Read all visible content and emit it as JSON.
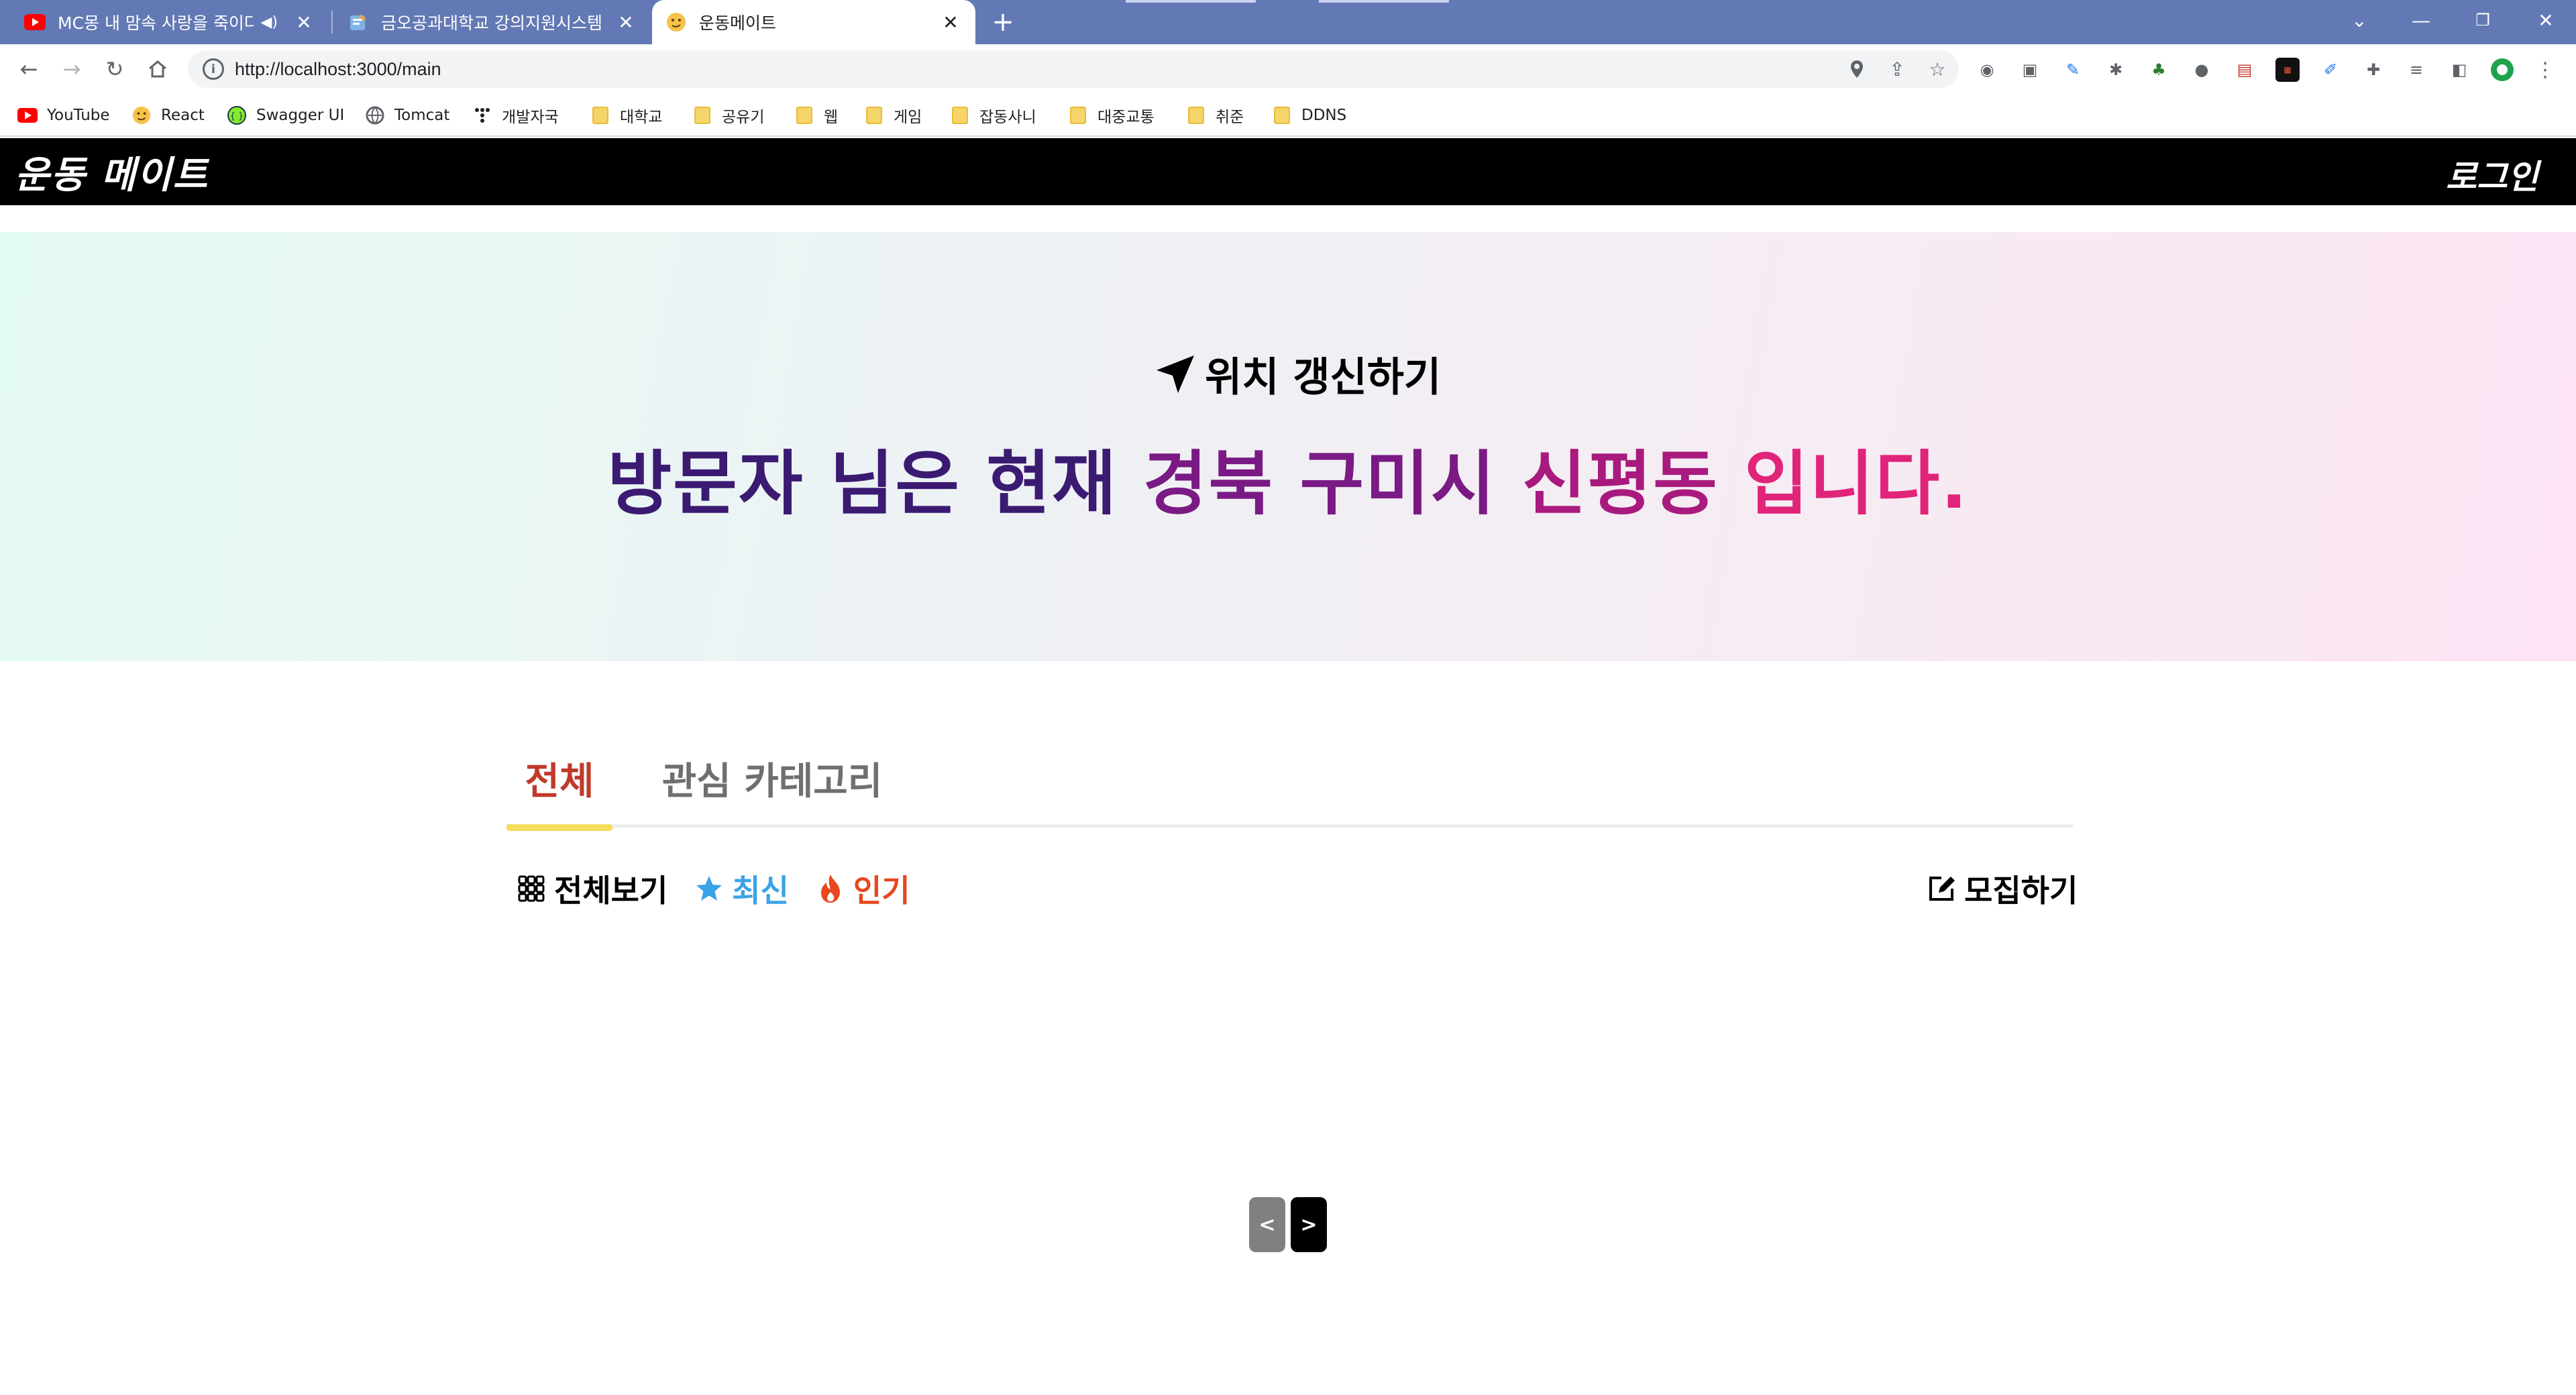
{
  "browser": {
    "tabs": [
      {
        "title": "MC몽 내 맘속 사랑을 죽이다",
        "icon": "youtube-icon",
        "audio": "speaker-icon"
      },
      {
        "title": "금오공과대학교 강의지원시스템",
        "icon": "notepad-icon"
      },
      {
        "title": "운동메이트",
        "icon": "emoji-icon",
        "active": true
      }
    ],
    "url": "http://localhost:3000/main",
    "bookmarks": [
      {
        "label": "YouTube",
        "icon": "youtube-icon"
      },
      {
        "label": "React",
        "icon": "emoji-icon"
      },
      {
        "label": "Swagger UI",
        "icon": "swagger-icon"
      },
      {
        "label": "Tomcat",
        "icon": "globe-icon"
      },
      {
        "label": "개발자국",
        "icon": "dots-icon"
      },
      {
        "label": "대학교",
        "icon": "folder-icon"
      },
      {
        "label": "공유기",
        "icon": "folder-icon"
      },
      {
        "label": "웹",
        "icon": "folder-icon"
      },
      {
        "label": "게임",
        "icon": "folder-icon"
      },
      {
        "label": "잡동사니",
        "icon": "folder-icon"
      },
      {
        "label": "대중교통",
        "icon": "folder-icon"
      },
      {
        "label": "취준",
        "icon": "folder-icon"
      },
      {
        "label": "DDNS",
        "icon": "folder-icon"
      }
    ]
  },
  "app": {
    "brand": "운동 메이트",
    "login": "로그인",
    "hero": {
      "location_button": "위치 갱신하기",
      "headline_prefix": "방문자 님은 현재",
      "region": "경북",
      "city": "구미시",
      "district": "신평동",
      "headline_suffix": "입니다."
    },
    "category_tabs": [
      {
        "label": "전체",
        "active": true
      },
      {
        "label": "관심 카테고리",
        "active": false
      }
    ],
    "filters": {
      "all": "전체보기",
      "latest": "최신",
      "popular": "인기"
    },
    "recruit": "모집하기",
    "pagination": {
      "prev": "<",
      "next": ">"
    }
  },
  "colors": {
    "tabstrip": "#6379b5",
    "active_tab": "#c0392b",
    "tab_underline": "#f5dc5c",
    "latest": "#3ba4e6",
    "popular": "#e8471f"
  }
}
